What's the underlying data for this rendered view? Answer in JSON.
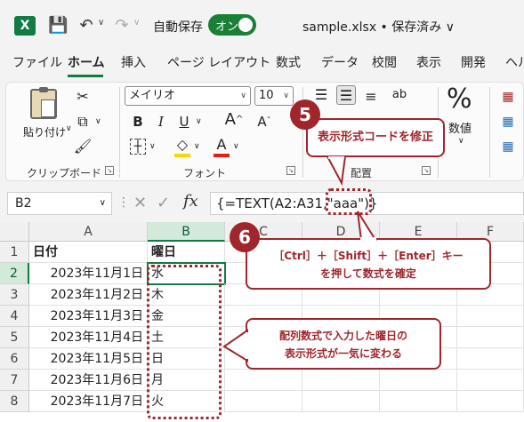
{
  "titlebar": {
    "app_logo": "X",
    "autosave_label": "自動保存",
    "toggle_label": "オン",
    "filename": "sample.xlsx • 保存済み ∨"
  },
  "tabs": [
    "ファイル",
    "ホーム",
    "挿入",
    "ページ レイアウト",
    "数式",
    "データ",
    "校閲",
    "表示",
    "開発",
    "ヘル"
  ],
  "ribbon": {
    "clipboard": {
      "paste_label": "貼り付け",
      "group_label": "クリップボード"
    },
    "font": {
      "font_name": "メイリオ",
      "font_size": "10",
      "group_label": "フォント",
      "grow": "A",
      "shrink": "A"
    },
    "alignment": {
      "group_label": "配置"
    },
    "number": {
      "label": "数値",
      "glyph": "%"
    }
  },
  "formula_bar": {
    "namebox": "B2",
    "formula": "{=TEXT(A2:A31,\"aaa\")}"
  },
  "sheet": {
    "columns": [
      "A",
      "B",
      "C",
      "D",
      "E",
      "F"
    ],
    "rows": [
      "1",
      "2",
      "3",
      "4",
      "5",
      "6",
      "7",
      "8"
    ],
    "headers": {
      "a1": "日付",
      "b1": "曜日"
    },
    "data": [
      {
        "date": "2023年11月1日",
        "dow": "水"
      },
      {
        "date": "2023年11月2日",
        "dow": "木"
      },
      {
        "date": "2023年11月3日",
        "dow": "金"
      },
      {
        "date": "2023年11月4日",
        "dow": "土"
      },
      {
        "date": "2023年11月5日",
        "dow": "日"
      },
      {
        "date": "2023年11月6日",
        "dow": "月"
      },
      {
        "date": "2023年11月7日",
        "dow": "火"
      }
    ]
  },
  "callouts": {
    "c5": {
      "num": "5",
      "text": "表示形式コードを修正"
    },
    "c6": {
      "num": "6",
      "line1": "［Ctrl］＋［Shift］＋［Enter］キー",
      "line2": "を押して数式を確定"
    },
    "c7": {
      "line1": "配列数式で入力した曜日の",
      "line2": "表示形式が一気に変わる"
    }
  },
  "colors": {
    "accent": "#107c41",
    "callout": "#a0262c"
  }
}
